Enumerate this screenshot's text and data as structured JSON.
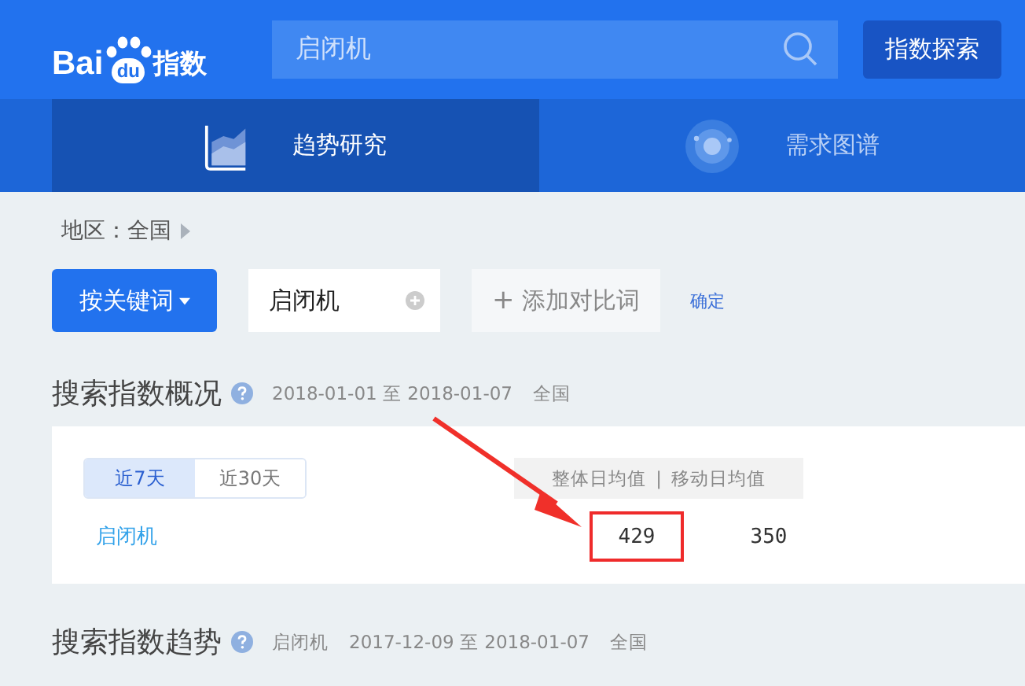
{
  "logo": {
    "left": "Bai",
    "paw": "du",
    "right": "指数"
  },
  "search": {
    "value": "启闭机",
    "button": "指数探索"
  },
  "tabs": [
    {
      "label": "趋势研究",
      "kind": "chart",
      "selected": true
    },
    {
      "label": "需求图谱",
      "kind": "target",
      "selected": false
    }
  ],
  "region": {
    "label": "地区：全国"
  },
  "controls": {
    "mode_button": "按关键词",
    "keyword": "启闭机",
    "add_compare": "添加对比词",
    "add_sign": "+",
    "confirm": "确定"
  },
  "overview": {
    "title": "搜索指数概况",
    "meta": [
      "2018-01-01 至 2018-01-07",
      "全国"
    ],
    "periods": [
      {
        "label": "近7天",
        "selected": true
      },
      {
        "label": "近30天",
        "selected": false
      }
    ],
    "columns": [
      "整体日均值",
      "移动日均值"
    ],
    "separator": "|",
    "rows": [
      {
        "keyword": "启闭机",
        "values": [
          {
            "text": "429",
            "highlighted": true
          },
          {
            "text": "350",
            "highlighted": false
          }
        ]
      }
    ]
  },
  "trend": {
    "title": "搜索指数趋势",
    "meta": [
      "启闭机",
      "2017-12-09 至 2018-01-07",
      "全国"
    ]
  }
}
